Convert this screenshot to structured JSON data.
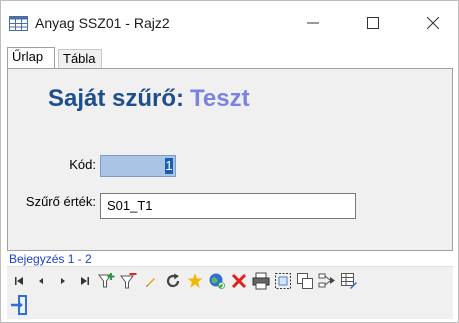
{
  "window": {
    "title": "Anyag SSZ01 - Rajz2",
    "minimize_glyph": "—",
    "maximize_glyph": "☐",
    "close_glyph": "✕"
  },
  "tabs": [
    {
      "label": "Űrlap",
      "active": true
    },
    {
      "label": "Tábla",
      "active": false
    }
  ],
  "form": {
    "heading_label": "Saját szűrő:",
    "heading_value": "Teszt",
    "kod_label": "Kód:",
    "kod_value": "1",
    "szuro_label": "Szűrő érték:",
    "szuro_value": "S01_T1"
  },
  "record_nav": {
    "text": "Bejegyzés 1 - 2"
  },
  "colors": {
    "heading_label": "#1f4e8c",
    "heading_value": "#7b83e0",
    "record_text": "#1a3fd0",
    "selection": "#1a5fb4"
  },
  "toolbar_icons": [
    "first-record-icon",
    "previous-record-icon",
    "next-record-icon",
    "last-record-icon",
    "add-filter-icon",
    "remove-filter-icon",
    "edit-icon",
    "refresh-icon",
    "new-record-icon",
    "web-icon",
    "delete-icon",
    "print-icon",
    "select-icon",
    "copy-icon",
    "export-icon",
    "table-edit-icon",
    "exit-icon"
  ]
}
